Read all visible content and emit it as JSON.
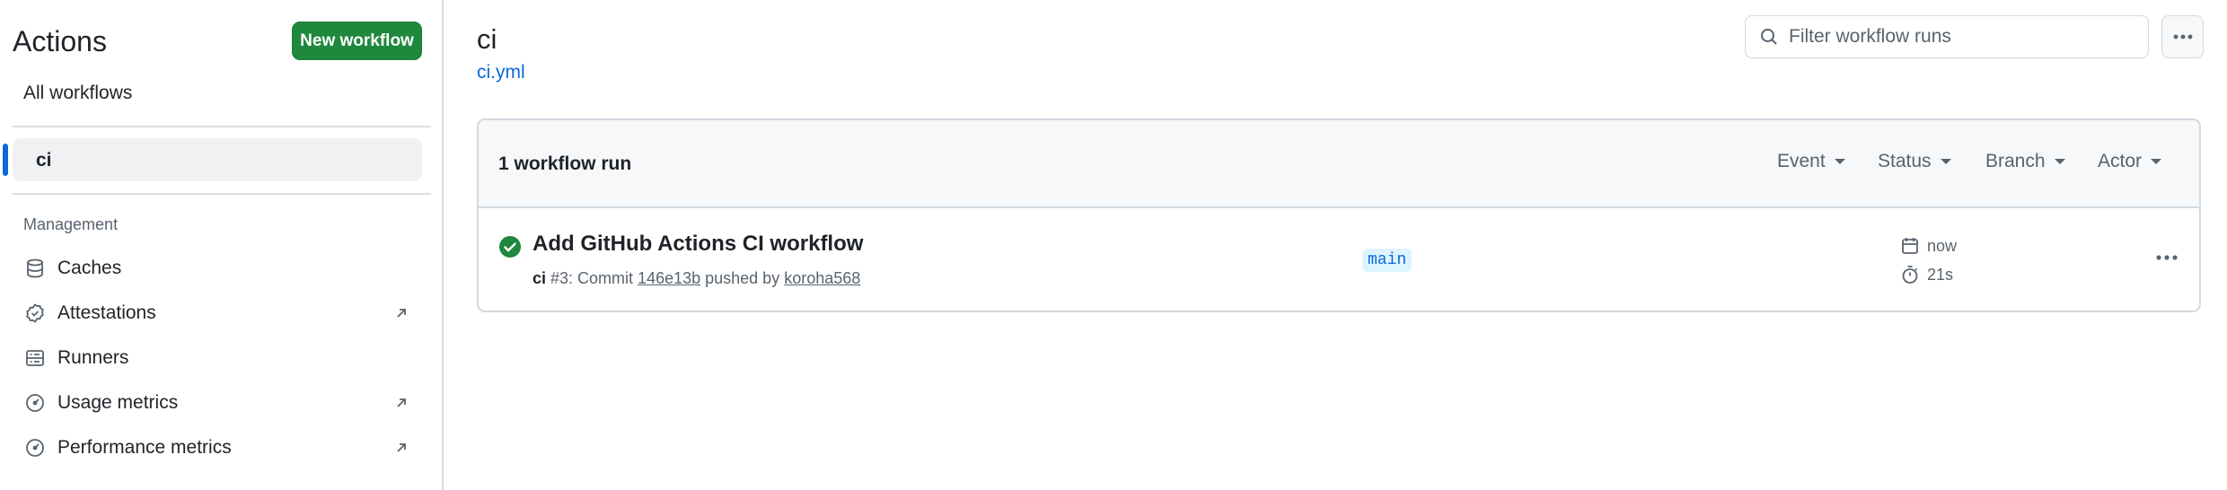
{
  "sidebar": {
    "title": "Actions",
    "new_workflow_label": "New workflow",
    "all_workflows_label": "All workflows",
    "selected_workflow": "ci",
    "management_heading": "Management",
    "links": [
      {
        "label": "Caches",
        "icon": "database-icon",
        "external": false
      },
      {
        "label": "Attestations",
        "icon": "verified-icon",
        "external": true
      },
      {
        "label": "Runners",
        "icon": "server-icon",
        "external": false
      },
      {
        "label": "Usage metrics",
        "icon": "meter-icon",
        "external": true
      },
      {
        "label": "Performance metrics",
        "icon": "meter-icon",
        "external": true
      }
    ]
  },
  "header": {
    "title": "ci",
    "file_link": "ci.yml",
    "filter_placeholder": "Filter workflow runs"
  },
  "runs": {
    "count_label": "1 workflow run",
    "filters": [
      "Event",
      "Status",
      "Branch",
      "Actor"
    ],
    "items": [
      {
        "title": "Add GitHub Actions CI workflow",
        "status": "success",
        "workflow": "ci",
        "meta_run": " #3: Commit ",
        "commit": "146e13b",
        "meta_pushed": " pushed by ",
        "actor": "koroha568",
        "branch": "main",
        "time": "now",
        "duration": "21s"
      }
    ]
  },
  "colors": {
    "accent": "#0969da",
    "success": "#1f883d",
    "muted": "#59636e",
    "border": "#d1d9e0"
  }
}
